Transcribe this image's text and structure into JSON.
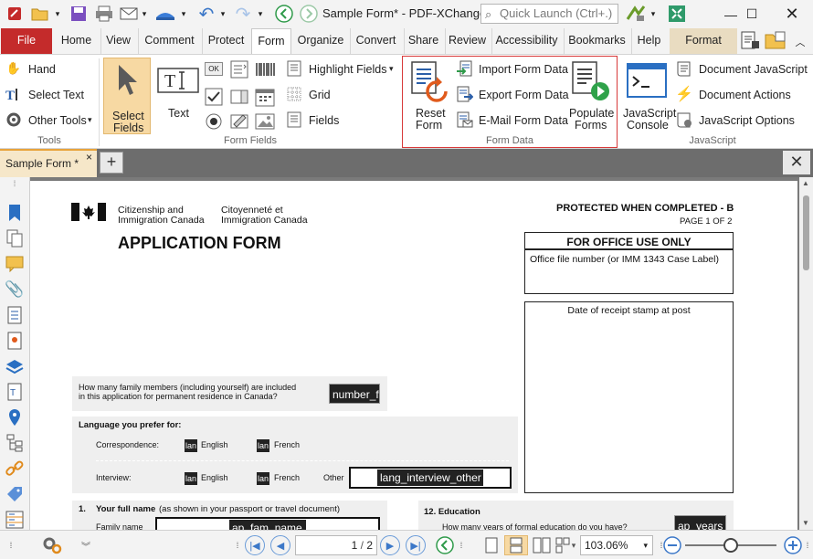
{
  "window": {
    "title": "Sample Form* - PDF-XChange ..",
    "quick_launch_placeholder": "Quick Launch (Ctrl+.)"
  },
  "ribbon_tabs": [
    "File",
    "Home",
    "View",
    "Comment",
    "Protect",
    "Form",
    "Organize",
    "Convert",
    "Share",
    "Review",
    "Accessibility",
    "Bookmarks",
    "Help",
    "Format"
  ],
  "active_tab": "Form",
  "ribbon": {
    "tools": {
      "hand": "Hand",
      "select_text": "Select Text",
      "other_tools": "Other Tools",
      "caption": "Tools"
    },
    "form_fields": {
      "select_fields_line1": "Select",
      "select_fields_line2": "Fields",
      "text": "Text",
      "highlight_fields": "Highlight Fields",
      "grid": "Grid",
      "fields": "Fields",
      "caption": "Form Fields"
    },
    "form_data": {
      "reset_line1": "Reset",
      "reset_line2": "Form",
      "import": "Import Form Data",
      "export": "Export Form Data",
      "email": "E-Mail Form Data",
      "populate_line1": "Populate",
      "populate_line2": "Forms",
      "caption": "Form Data"
    },
    "javascript": {
      "console_line1": "JavaScript",
      "console_line2": "Console",
      "document_js": "Document JavaScript",
      "document_actions": "Document Actions",
      "js_options": "JavaScript Options",
      "caption": "JavaScript"
    }
  },
  "document_tab": {
    "label": "Sample Form *",
    "close": "×"
  },
  "pdf": {
    "agency_en_1": "Citizenship and",
    "agency_en_2": "Immigration Canada",
    "agency_fr_1": "Citoyenneté et",
    "agency_fr_2": "Immigration Canada",
    "form_title": "APPLICATION FORM",
    "protected": "PROTECTED WHEN COMPLETED - B",
    "page_of": "PAGE 1 OF 2",
    "office_use_title": "FOR OFFICE USE ONLY",
    "office_file_label": "Office file number (or IMM 1343 Case Label)",
    "receipt_stamp_label": "Date of receipt stamp at post",
    "family_q_1": "How many family members (including yourself) are included",
    "family_q_2": "in this application for permanent residence in Canada?",
    "family_field": "number_f",
    "language_heading": "Language you prefer for:",
    "correspondence": "Correspondence:",
    "interview": "Interview:",
    "english": "English",
    "french": "French",
    "other": "Other",
    "checkbox_text": "lan",
    "interview_other_field": "lang_interview_other",
    "q1_number": "1.",
    "q1_label": "Your full name",
    "q1_hint": "(as shown in your passport or travel document)",
    "family_name_label": "Family name",
    "family_name_field": "ap_fam_name",
    "q12_label": "12.  Education",
    "education_q": "How many years of formal education do you have?",
    "years_field": "ap_years"
  },
  "status": {
    "page_current": "1",
    "page_total": "2",
    "zoom": "103.06%"
  }
}
